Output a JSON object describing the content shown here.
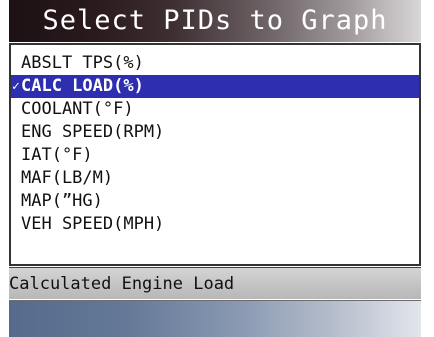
{
  "header": {
    "title": "Select PIDs to Graph"
  },
  "pid_list": {
    "items": [
      {
        "label": "ABSLT TPS(%)",
        "selected": false,
        "checked": false,
        "check_mark": ""
      },
      {
        "label": "CALC LOAD(%)",
        "selected": true,
        "checked": true,
        "check_mark": "✓"
      },
      {
        "label": "COOLANT(°F)",
        "selected": false,
        "checked": false,
        "check_mark": ""
      },
      {
        "label": "ENG SPEED(RPM)",
        "selected": false,
        "checked": false,
        "check_mark": ""
      },
      {
        "label": "IAT(°F)",
        "selected": false,
        "checked": false,
        "check_mark": ""
      },
      {
        "label": "MAF(LB/M)",
        "selected": false,
        "checked": false,
        "check_mark": ""
      },
      {
        "label": "MAP(”HG)",
        "selected": false,
        "checked": false,
        "check_mark": ""
      },
      {
        "label": "VEH SPEED(MPH)",
        "selected": false,
        "checked": false,
        "check_mark": ""
      }
    ]
  },
  "status": {
    "description": "Calculated Engine Load"
  },
  "colors": {
    "selected_row": "#2e2fb0",
    "title_gradient_dark": "#1c1114",
    "bottom_bar_accent": "#566a8c"
  }
}
